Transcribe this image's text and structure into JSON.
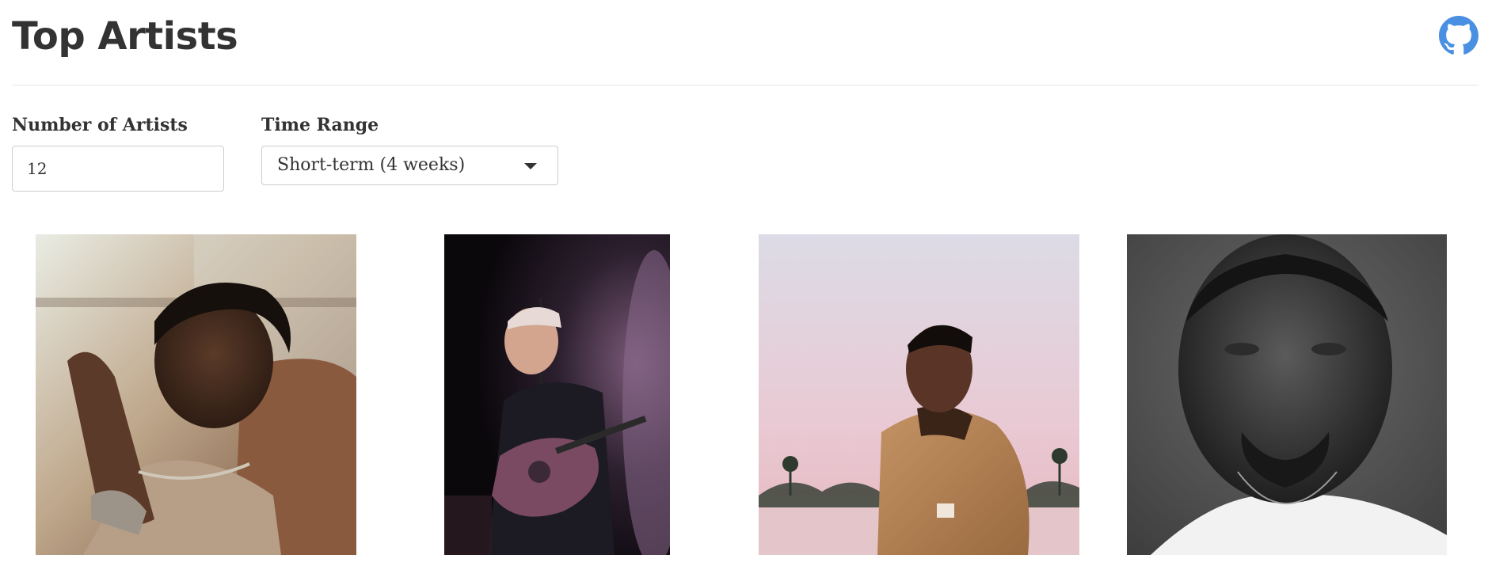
{
  "page": {
    "title": "Top Artists"
  },
  "header": {
    "github_icon": "github-icon",
    "github_color": "#4a90e2"
  },
  "controls": {
    "number_label": "Number of Artists",
    "number_value": "12",
    "range_label": "Time Range",
    "range_selected": "Short-term (4 weeks)"
  },
  "artists": [
    {
      "photo": "artist-photo-portrait-warm"
    },
    {
      "photo": "artist-photo-guitarist-stage"
    },
    {
      "photo": "artist-photo-sunset-portrait"
    },
    {
      "photo": "artist-photo-monochrome-portrait"
    }
  ],
  "colors": {
    "text": "#333333",
    "divider": "#e6e6e6",
    "border": "#cccccc"
  }
}
